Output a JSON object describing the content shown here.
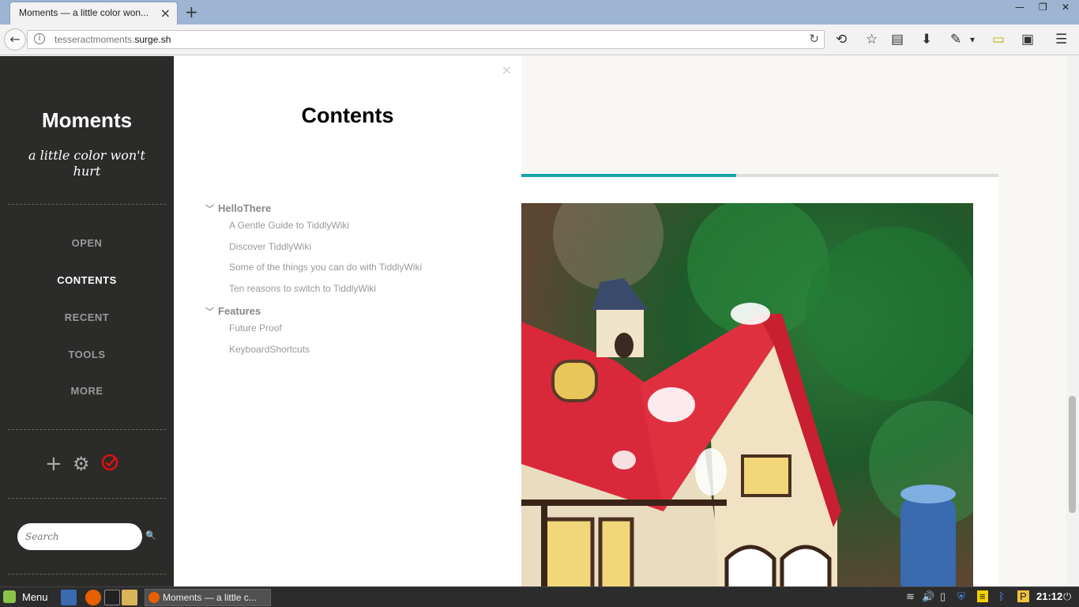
{
  "browser": {
    "tab_title": "Moments — a little color won...",
    "url_prefix": "tesseractmoments.",
    "url_domain": "surge.sh"
  },
  "sidebar": {
    "title": "Moments",
    "subtitle": "a little color won't hurt",
    "nav": [
      "OPEN",
      "CONTENTS",
      "RECENT",
      "TOOLS",
      "MORE"
    ],
    "active_nav": "CONTENTS",
    "search_placeholder": "Search",
    "icons": [
      "plus-icon",
      "gear-icon",
      "check-circle-icon"
    ]
  },
  "panel": {
    "title": "Contents",
    "groups": [
      {
        "label": "HelloThere",
        "items": [
          "A Gentle Guide to TiddlyWiki",
          "Discover TiddlyWiki",
          "Some of the things you can do with TiddlyWiki",
          "Ten reasons to switch to TiddlyWiki"
        ]
      },
      {
        "label": "Features",
        "items": [
          "Future Proof",
          "KeyboardShortcuts"
        ]
      }
    ]
  },
  "content": {
    "progress_fraction": 0.45,
    "accent_color": "#1aa6a6"
  },
  "taskbar": {
    "menu_label": "Menu",
    "window_title": "Moments — a little c...",
    "clock": "21:12"
  }
}
